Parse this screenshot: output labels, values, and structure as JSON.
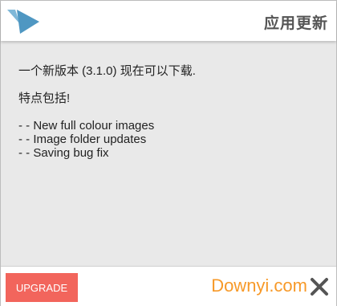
{
  "header": {
    "title": "应用更新",
    "logo_color": "#5aa0c8"
  },
  "body": {
    "line1": "一个新版本 (3.1.0) 现在可以下载.",
    "line2": "特点包括!",
    "features": [
      "- - New full colour images",
      "- - Image folder updates",
      "- - Saving bug fix"
    ]
  },
  "footer": {
    "upgrade_label": "UPGRADE",
    "upgrade_color": "#f2655c",
    "watermark": "Downyi.com",
    "close_icon": "close-icon"
  }
}
